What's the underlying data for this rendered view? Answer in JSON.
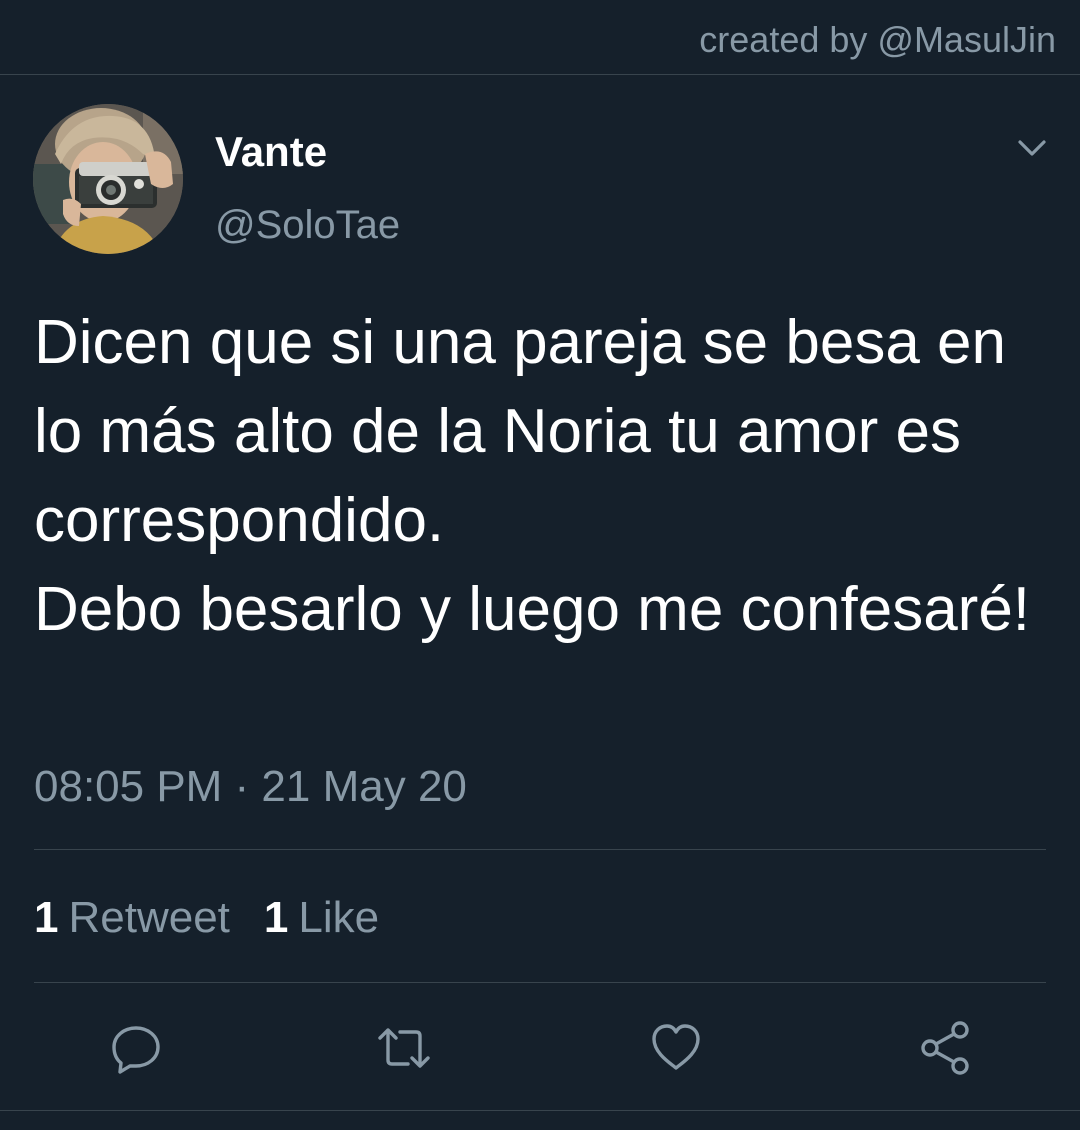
{
  "credit": "created by @MasulJin",
  "tweet": {
    "author": {
      "display_name": "Vante",
      "handle": "@SoloTae"
    },
    "text": "Dicen que si una pareja se besa en lo más alto de la Noria tu amor es correspondido.\nDebo besarlo y luego me confesaré!",
    "timestamp": "08:05 PM · 21 May 20",
    "stats": {
      "retweets_count": "1",
      "retweets_label": "Retweet",
      "likes_count": "1",
      "likes_label": "Like"
    },
    "actions": [
      "reply-icon",
      "retweet-icon",
      "like-icon",
      "share-icon"
    ]
  },
  "colors": {
    "background": "#15202b",
    "text": "#ffffff",
    "secondary": "#8899a6",
    "divider": "#38444d"
  }
}
